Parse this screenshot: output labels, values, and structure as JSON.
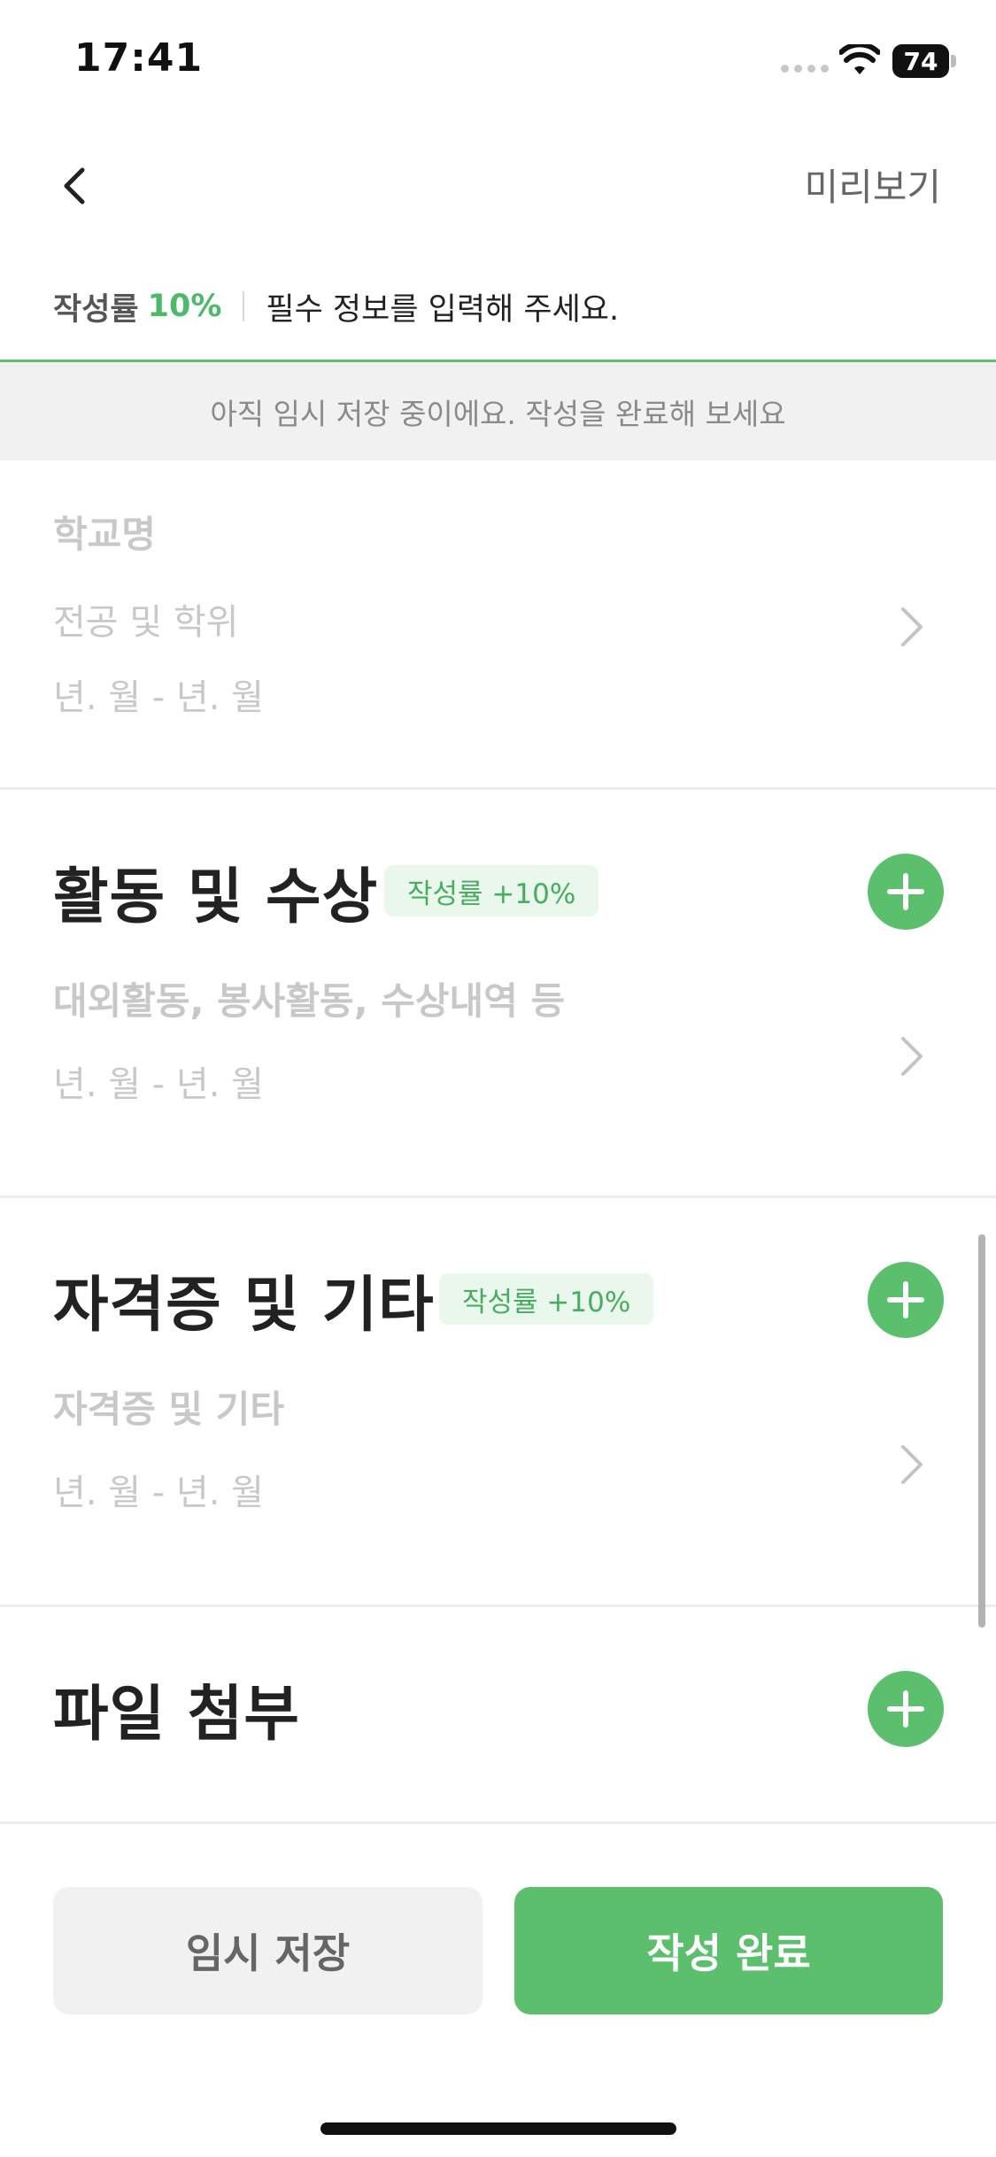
{
  "status_bar": {
    "time": "17:41",
    "battery": "74"
  },
  "nav": {
    "preview_label": "미리보기"
  },
  "progress": {
    "label": "작성률",
    "value": "10%",
    "hint": "필수 정보를 입력해 주세요.",
    "accent_color": "#5bbf6e"
  },
  "draft_banner": "아직 임시 저장 중이에요. 작성을 완료해 보세요",
  "education": {
    "school_placeholder": "학교명",
    "major_placeholder": "전공 및 학위",
    "period_placeholder": "년. 월 - 년. 월"
  },
  "activities": {
    "title": "활동 및 수상",
    "badge": "작성률 +10%",
    "item_placeholder": "대외활동, 봉사활동, 수상내역 등",
    "period_placeholder": "년. 월 - 년. 월"
  },
  "certificates": {
    "title": "자격증 및 기타",
    "badge": "작성률 +10%",
    "item_placeholder": "자격증 및 기타",
    "period_placeholder": "년. 월 - 년. 월"
  },
  "attachments": {
    "title": "파일 첨부"
  },
  "actions": {
    "draft_label": "임시 저장",
    "complete_label": "작성 완료"
  },
  "icons": [
    "back-chevron-icon",
    "chevron-right-icon",
    "plus-icon",
    "wifi-icon",
    "battery-icon"
  ]
}
